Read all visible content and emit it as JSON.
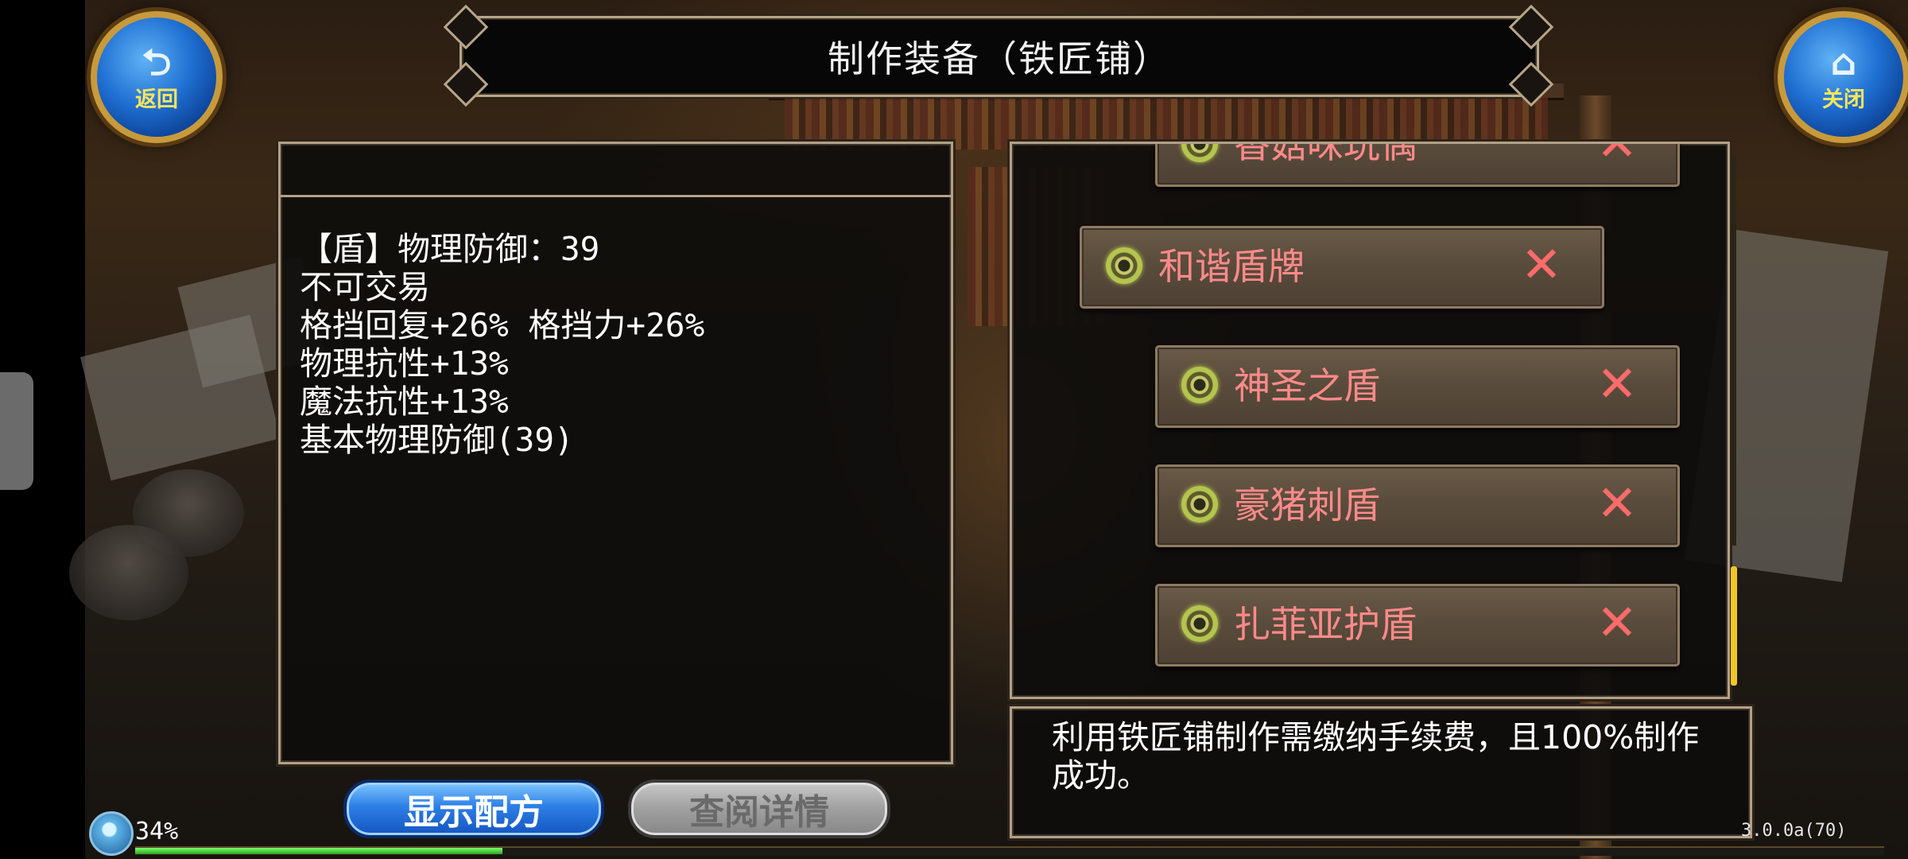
{
  "header": {
    "title": "制作装备（铁匠铺）"
  },
  "buttons": {
    "back": {
      "label": "返回",
      "icon": "back-arrow-icon"
    },
    "close": {
      "label": "关闭",
      "icon": "home-icon"
    },
    "show_recipe": "显示配方",
    "view_details": "查阅详情"
  },
  "item_info": {
    "lines": [
      "【盾】物理防御：39",
      "不可交易",
      "格挡回复+26% 格挡力+26%",
      "物理抗性+13%",
      "魔法抗性+13%",
      "基本物理防御(39)"
    ]
  },
  "recipe_list": {
    "items": [
      {
        "label": "香菇味玩偶",
        "status_icon": "x-icon",
        "selected": false
      },
      {
        "label": "和谐盾牌",
        "status_icon": "x-icon",
        "selected": true
      },
      {
        "label": "神圣之盾",
        "status_icon": "x-icon",
        "selected": false
      },
      {
        "label": "豪猪刺盾",
        "status_icon": "x-icon",
        "selected": false
      },
      {
        "label": "扎菲亚护盾",
        "status_icon": "x-icon",
        "selected": false
      }
    ]
  },
  "description": {
    "text": "利用铁匠铺制作需缴纳手续费，且100%制作成功。"
  },
  "hud": {
    "exp_percent": "34%",
    "exp_fraction": 0.21,
    "version": "3.0.0a(70)"
  },
  "colors": {
    "item_label": "#ff8a8a",
    "x_mark": "#ff6b6b",
    "primary_button": "#2d7fe6",
    "disabled_button": "#a0a0a0",
    "scroll_thumb": "#f0c628",
    "exp_bar": "#2aa51e"
  }
}
